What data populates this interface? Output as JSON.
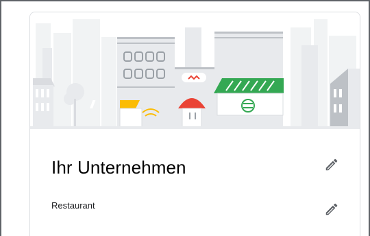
{
  "business": {
    "name": "Ihr Unternehmen",
    "category": "Restaurant"
  },
  "icons": {
    "edit_name": "pencil-icon",
    "edit_category": "pencil-icon",
    "illustration": "storefront-illustration"
  },
  "colors": {
    "frame": "#5f6368",
    "card_border": "#dadce0",
    "awning_green": "#34a853",
    "awning_yellow": "#fbbc04",
    "awning_red": "#ea4335",
    "building_gray": "#e8eaed"
  }
}
